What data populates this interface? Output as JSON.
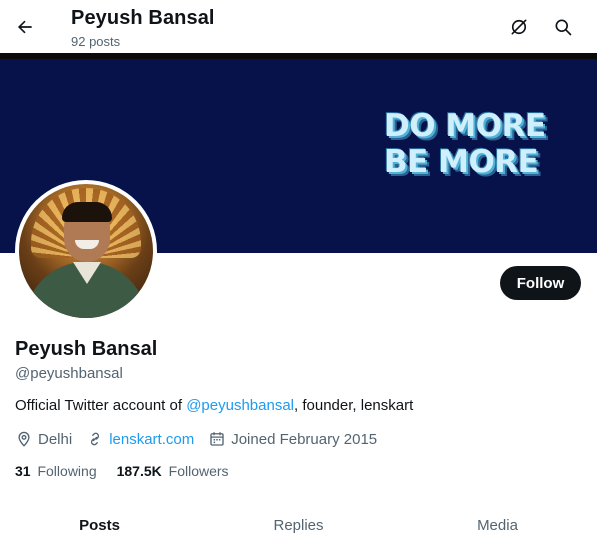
{
  "header": {
    "title": "Peyush Bansal",
    "posts_count": "92 posts",
    "back_icon": "arrow-left-icon",
    "grok_icon": "grok-icon",
    "search_icon": "search-icon"
  },
  "banner": {
    "line1": "DO MORE",
    "line2": "BE MORE",
    "background": "#08124a"
  },
  "profile": {
    "display_name": "Peyush Bansal",
    "handle": "@peyushbansal",
    "bio_prefix": "Official Twitter account of ",
    "bio_mention": "@peyushbansal",
    "bio_suffix": ", founder, lenskart",
    "location": "Delhi",
    "website": "lenskart.com",
    "joined": "Joined February 2015",
    "following_count": "31",
    "following_label": "Following",
    "followers_count": "187.5K",
    "followers_label": "Followers"
  },
  "follow_button": {
    "label": "Follow"
  },
  "tabs": [
    {
      "label": "Posts",
      "active": true
    },
    {
      "label": "Replies",
      "active": false
    },
    {
      "label": "Media",
      "active": false
    }
  ],
  "colors": {
    "accent": "#1d9bf0",
    "text_primary": "#0f1419",
    "text_secondary": "#536471"
  }
}
